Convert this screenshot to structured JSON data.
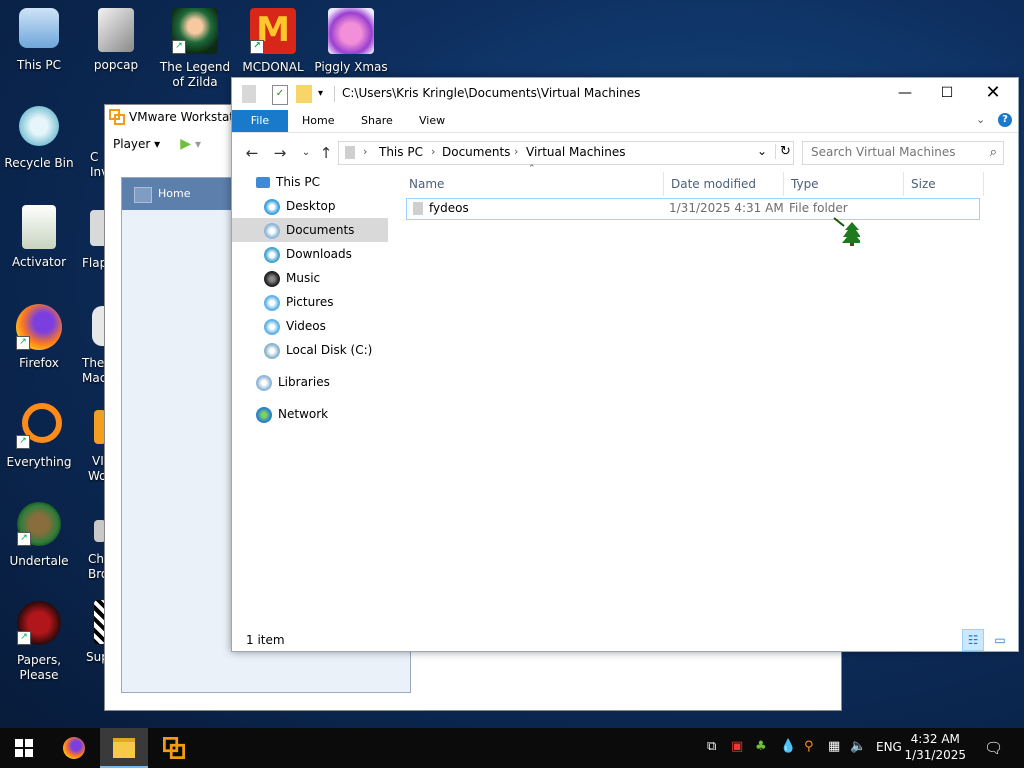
{
  "desktop": {
    "icons": [
      {
        "label": "This PC"
      },
      {
        "label": "Recycle Bin"
      },
      {
        "label": "Activator"
      },
      {
        "label": "Firefox"
      },
      {
        "label": "Everything"
      },
      {
        "label": "Undertale"
      },
      {
        "label": "Papers, Please"
      },
      {
        "label": "popcap"
      },
      {
        "label": "C"
      },
      {
        "label": "Flap"
      },
      {
        "label": "The"
      },
      {
        "label": "VI"
      },
      {
        "label": "Ch"
      },
      {
        "label": "Sup"
      },
      {
        "label": "The Legend of Zilda"
      },
      {
        "label": "MCDONAL"
      },
      {
        "label": "Piggly Xmas"
      }
    ],
    "sub_labels": {
      "c": "Inv",
      "the": "Mac",
      "vi": "Wo",
      "ch": "Bro"
    }
  },
  "vmware": {
    "title": "VMware Workstatio",
    "player_label": "Player",
    "home_label": "Home"
  },
  "explorer": {
    "title_path": "C:\\Users\\Kris Kringle\\Documents\\Virtual Machines",
    "ribbon_tabs": [
      "File",
      "Home",
      "Share",
      "View"
    ],
    "breadcrumb": [
      "This PC",
      "Documents",
      "Virtual Machines"
    ],
    "search_placeholder": "Search Virtual Machines",
    "nav": [
      {
        "label": "This PC"
      },
      {
        "label": "Desktop"
      },
      {
        "label": "Documents"
      },
      {
        "label": "Downloads"
      },
      {
        "label": "Music"
      },
      {
        "label": "Pictures"
      },
      {
        "label": "Videos"
      },
      {
        "label": "Local Disk (C:)"
      },
      {
        "label": "Libraries"
      },
      {
        "label": "Network"
      }
    ],
    "columns": [
      "Name",
      "Date modified",
      "Type",
      "Size"
    ],
    "files": [
      {
        "name": "fydeos",
        "date": "1/31/2025 4:31 AM",
        "type": "File folder",
        "size": ""
      }
    ],
    "status": "1 item"
  },
  "taskbar": {
    "lang": "ENG",
    "time": "4:32 AM",
    "date": "1/31/2025"
  },
  "colors": {
    "accent": "#1979ca",
    "selection": "#cce8ff",
    "vmware_bar": "#5d7fab"
  }
}
